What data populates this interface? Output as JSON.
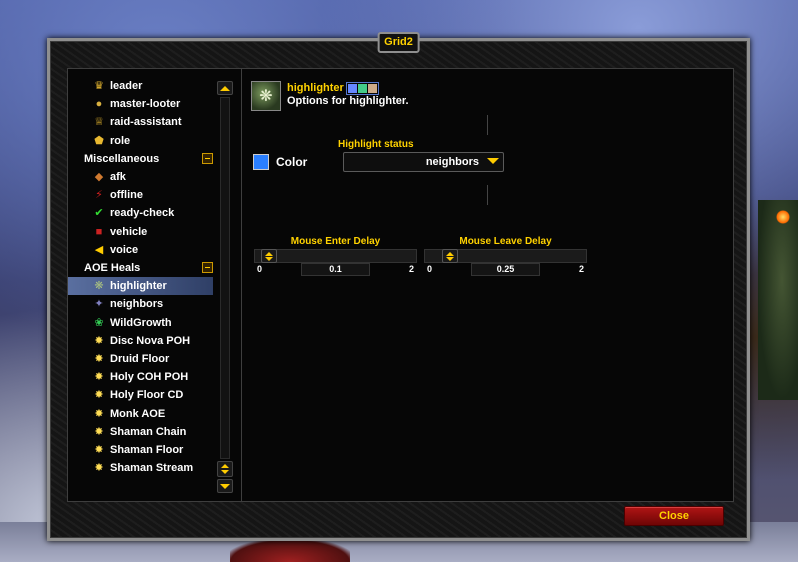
{
  "window": {
    "title": "Grid2"
  },
  "tree": {
    "rows": [
      {
        "label": "leader",
        "icon": "crown-icon",
        "glyph": "♛",
        "color": "#e8b830"
      },
      {
        "label": "master-looter",
        "icon": "loot-bag-icon",
        "glyph": "●",
        "color": "#d8b040"
      },
      {
        "label": "raid-assistant",
        "icon": "assistant-crown-icon",
        "glyph": "♕",
        "color": "#e8b830"
      },
      {
        "label": "role",
        "icon": "role-shield-icon",
        "glyph": "⬟",
        "color": "#e8b830"
      },
      {
        "label": "Miscellaneous",
        "category": true
      },
      {
        "label": "afk",
        "icon": "afk-icon",
        "glyph": "◆",
        "color": "#d07a30"
      },
      {
        "label": "offline",
        "icon": "offline-icon",
        "glyph": "⚡",
        "color": "#d02020"
      },
      {
        "label": "ready-check",
        "icon": "ready-check-icon",
        "glyph": "✔",
        "color": "#33dd33"
      },
      {
        "label": "vehicle",
        "icon": "vehicle-icon",
        "glyph": "■",
        "color": "#cc2222"
      },
      {
        "label": "voice",
        "icon": "voice-icon",
        "glyph": "◀",
        "color": "#ffcc00"
      },
      {
        "label": "AOE Heals",
        "category": true
      },
      {
        "label": "highlighter",
        "icon": "highlighter-icon",
        "glyph": "❋",
        "color": "#a8c080",
        "selected": true
      },
      {
        "label": "neighbors",
        "icon": "neighbors-icon",
        "glyph": "✦",
        "color": "#8080c0"
      },
      {
        "label": "WildGrowth",
        "icon": "wild-growth-icon",
        "glyph": "❀",
        "color": "#33cc55"
      },
      {
        "label": "Disc Nova POH",
        "icon": "holy-burst-icon",
        "glyph": "✸",
        "color": "#ffdd55"
      },
      {
        "label": "Druid Floor",
        "icon": "holy-burst-icon",
        "glyph": "✸",
        "color": "#ffdd55"
      },
      {
        "label": "Holy COH POH",
        "icon": "holy-burst-icon",
        "glyph": "✸",
        "color": "#ffdd55"
      },
      {
        "label": "Holy Floor CD",
        "icon": "holy-burst-icon",
        "glyph": "✸",
        "color": "#ffdd55"
      },
      {
        "label": "Monk AOE",
        "icon": "holy-burst-icon",
        "glyph": "✸",
        "color": "#ffdd55"
      },
      {
        "label": "Shaman Chain",
        "icon": "holy-burst-icon",
        "glyph": "✸",
        "color": "#ffdd55"
      },
      {
        "label": "Shaman Floor",
        "icon": "holy-burst-icon",
        "glyph": "✸",
        "color": "#ffdd55"
      },
      {
        "label": "Shaman Stream",
        "icon": "holy-burst-icon",
        "glyph": "✸",
        "color": "#ffdd55"
      }
    ]
  },
  "header": {
    "title": "highlighter",
    "description": "Options for highlighter.",
    "badges": [
      "#6688ff",
      "#44cc88",
      "#ccaa88"
    ]
  },
  "options": {
    "color_label": "Color",
    "color_value": "#2a7fff",
    "highlight_status_label": "Highlight status",
    "highlight_status_value": "neighbors",
    "mouse_enter": {
      "label": "Mouse Enter Delay",
      "min": "0",
      "max": "2",
      "value": "0.1",
      "fraction": 0.05
    },
    "mouse_leave": {
      "label": "Mouse Leave Delay",
      "min": "0",
      "max": "2",
      "value": "0.25",
      "fraction": 0.125
    }
  },
  "buttons": {
    "close": "Close"
  }
}
